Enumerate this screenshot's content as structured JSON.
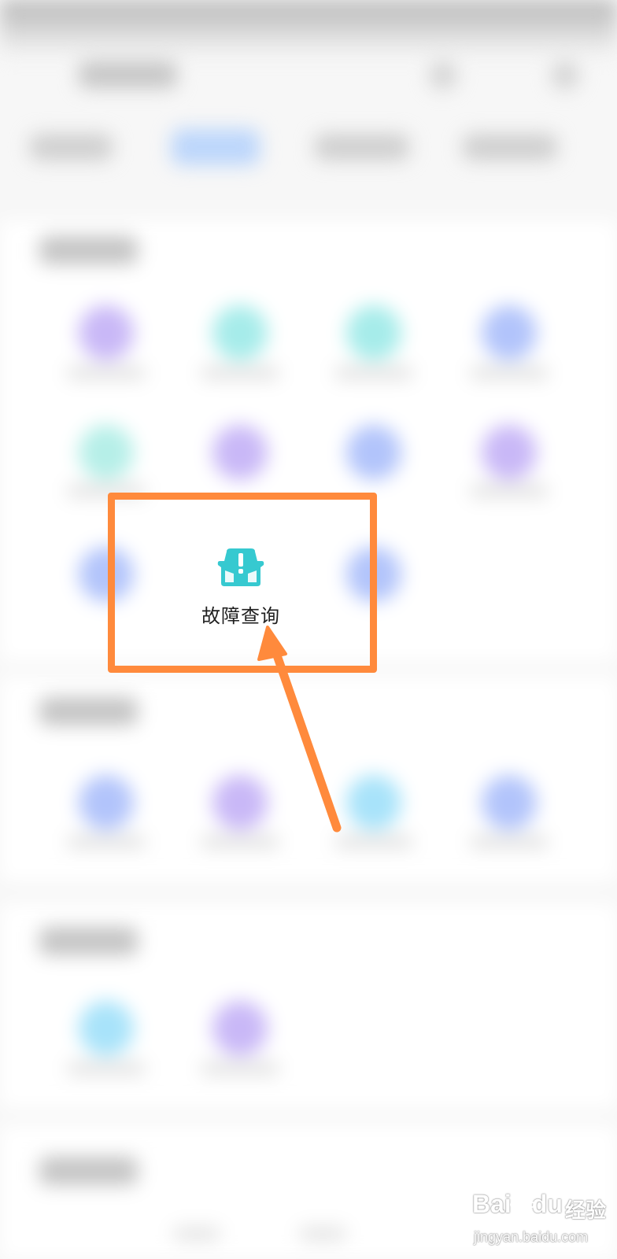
{
  "focus_item": {
    "label": "故障查询",
    "icon": "car-alert-icon",
    "icon_color": "#36c9d0"
  },
  "highlight": {
    "box_color": "#ff8a3c",
    "arrow_color": "#ff8a3c"
  },
  "watermark": {
    "logo_text": "Bai",
    "logo_text_suffix": "du",
    "brand_text": "经验",
    "url": "jingyan.baidu.com"
  },
  "colors": {
    "tile_purple": "#c9b8f7",
    "tile_teal": "#a6ecea",
    "tile_blue": "#b2c4fb",
    "tile_cyan": "#a8e3fa",
    "tab_active": "#bcd6fb"
  }
}
